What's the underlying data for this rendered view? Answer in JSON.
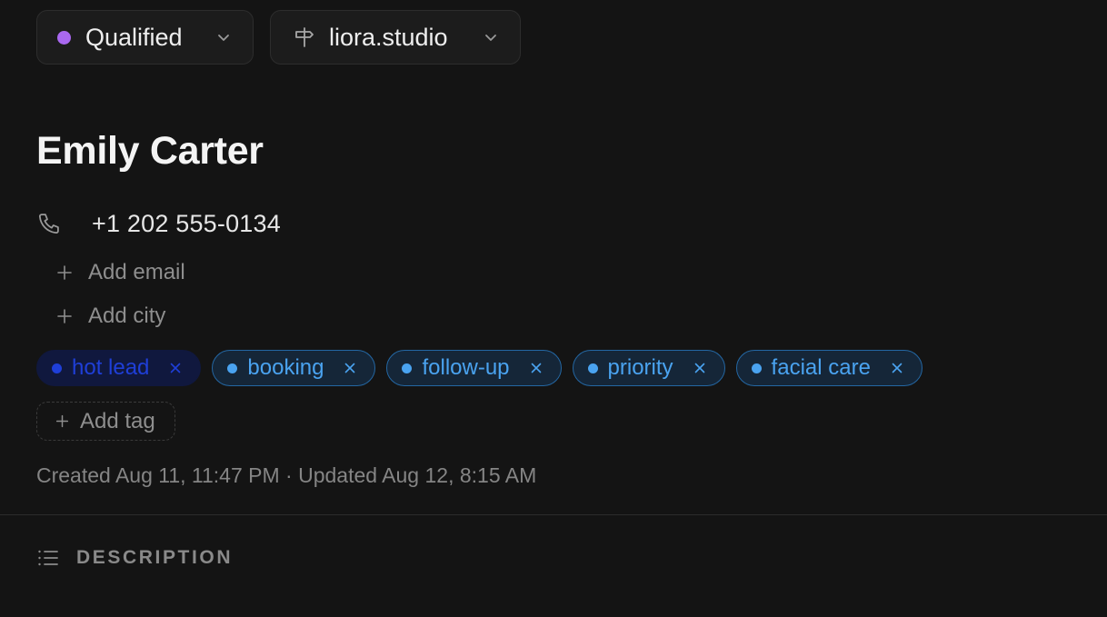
{
  "header": {
    "status": {
      "label": "Qualified",
      "dot_color": "#a968f0",
      "icon": "chevron-down-icon"
    },
    "site": {
      "label": "liora.studio",
      "icon": "signpost-icon"
    }
  },
  "contact": {
    "name": "Emily Carter",
    "phone": "+1 202 555-0134",
    "phone_icon": "phone-icon",
    "add_email_label": "Add email",
    "add_city_label": "Add city"
  },
  "tags": [
    {
      "label": "hot lead",
      "selected": true
    },
    {
      "label": "booking",
      "selected": false
    },
    {
      "label": "follow-up",
      "selected": false
    },
    {
      "label": "priority",
      "selected": false
    },
    {
      "label": "facial care",
      "selected": false
    }
  ],
  "add_tag_label": "Add tag",
  "meta": {
    "text": "Created Aug 11, 11:47 PM · Updated Aug 12, 8:15 AM"
  },
  "section": {
    "title": "DESCRIPTION",
    "icon": "list-icon"
  },
  "colors": {
    "background": "#141414",
    "tag_text": "#4aa3f0",
    "tag_selected_text": "#1f3fd8"
  }
}
